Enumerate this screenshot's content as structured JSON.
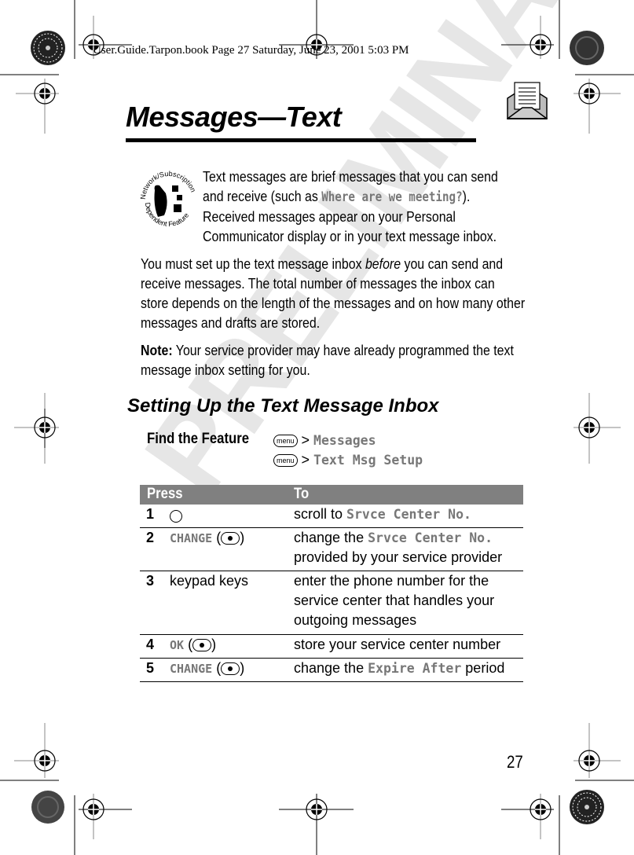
{
  "print_header": "User.Guide.Tarpon.book  Page 27  Saturday, June 23, 2001  5:03 PM",
  "watermark": "PRELIMINARY",
  "title": "Messages—Text",
  "feature_badge": {
    "top_text": "Network/Subscription",
    "bottom_text": "Dependent Feature"
  },
  "intro": {
    "before": "Text messages are brief messages that you can send and receive (such as ",
    "example": "Where are we meeting?",
    "after": "). Received messages appear on your Personal Communicator display or in your text message inbox."
  },
  "para1": {
    "before": "You must set up the text message inbox ",
    "emph": "before",
    "after": " you can send and receive messages. The total number of messages the inbox can store depends on the length of the messages and on how many other messages and drafts are stored."
  },
  "note": {
    "label": "Note:",
    "text": " Your service provider may have already programmed the text message inbox setting for you."
  },
  "section_title": "Setting Up the Text Message Inbox",
  "find_feature": {
    "label": "Find the Feature",
    "menu_key": "menu",
    "steps": [
      "Messages",
      "Text Msg Setup"
    ]
  },
  "table": {
    "headers": {
      "press": "Press",
      "to": "To"
    },
    "rows": [
      {
        "num": "1",
        "press_icon": "nav-key",
        "to_before": "scroll to ",
        "to_mono": "Srvce Center No.",
        "to_after": ""
      },
      {
        "num": "2",
        "press_soft": "CHANGE",
        "to_before": "change the ",
        "to_mono": "Srvce Center No.",
        "to_after": " provided by your service provider"
      },
      {
        "num": "3",
        "press_text": "keypad keys",
        "to_before": "enter the phone number for the service center that handles your outgoing messages",
        "to_mono": "",
        "to_after": ""
      },
      {
        "num": "4",
        "press_soft": "OK",
        "to_before": "store your service center number",
        "to_mono": "",
        "to_after": ""
      },
      {
        "num": "5",
        "press_soft": "CHANGE",
        "to_before": "change the ",
        "to_mono": "Expire After",
        "to_after": " period"
      }
    ]
  },
  "page_number": "27"
}
